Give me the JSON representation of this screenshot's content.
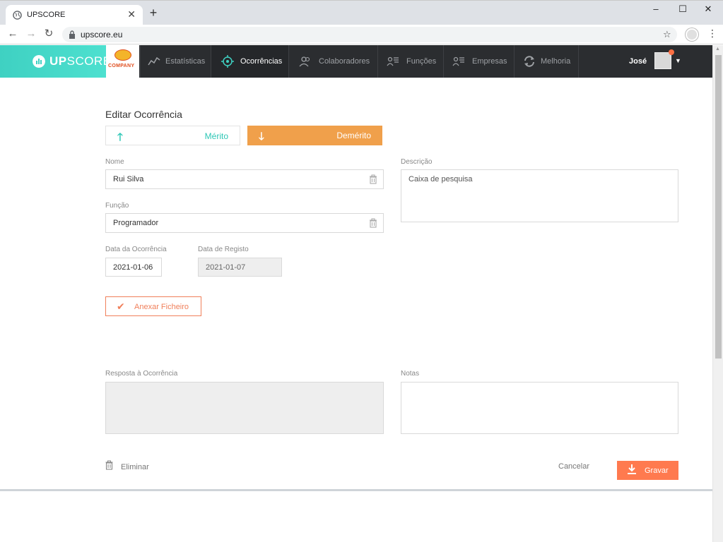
{
  "browser": {
    "tab_title": "UPSCORE",
    "tab_close": "✕",
    "new_tab": "+",
    "url": "upscore.eu",
    "win_minimize": "–",
    "win_maximize": "☐",
    "win_close": "✕"
  },
  "nav": {
    "brand_bold": "UP",
    "brand_light": "SCORE",
    "company_label": "COMPANY",
    "items": [
      {
        "label": "Estatísticas",
        "icon": "chart-line-icon"
      },
      {
        "label": "Ocorrências",
        "icon": "target-icon"
      },
      {
        "label": "Colaboradores",
        "icon": "users-icon"
      },
      {
        "label": "Funções",
        "icon": "roles-icon"
      },
      {
        "label": "Empresas",
        "icon": "company-icon"
      },
      {
        "label": "Melhoria",
        "icon": "refresh-icon"
      }
    ],
    "user_name": "José"
  },
  "form": {
    "title": "Editar Ocorrência",
    "merit_label": "Mérito",
    "demerit_label": "Demérito",
    "name_label": "Nome",
    "name_value": "Rui Silva",
    "role_label": "Função",
    "role_value": "Programador",
    "description_label": "Descrição",
    "description_value": "Caixa de pesquisa",
    "occurrence_date_label": "Data da Ocorrência",
    "occurrence_date_value": "2021-01-06",
    "registry_date_label": "Data de Registo",
    "registry_date_value": "2021-01-07",
    "attach_label": "Anexar Ficheiro",
    "response_label": "Resposta à Ocorrência",
    "notes_label": "Notas",
    "delete_label": "Eliminar",
    "cancel_label": "Cancelar",
    "save_label": "Gravar"
  },
  "colors": {
    "brand_teal": "#3fd1c2",
    "demerit_orange": "#f0a04b",
    "save_orange": "#ff7a4f",
    "nav_dark": "#2b2d30"
  }
}
